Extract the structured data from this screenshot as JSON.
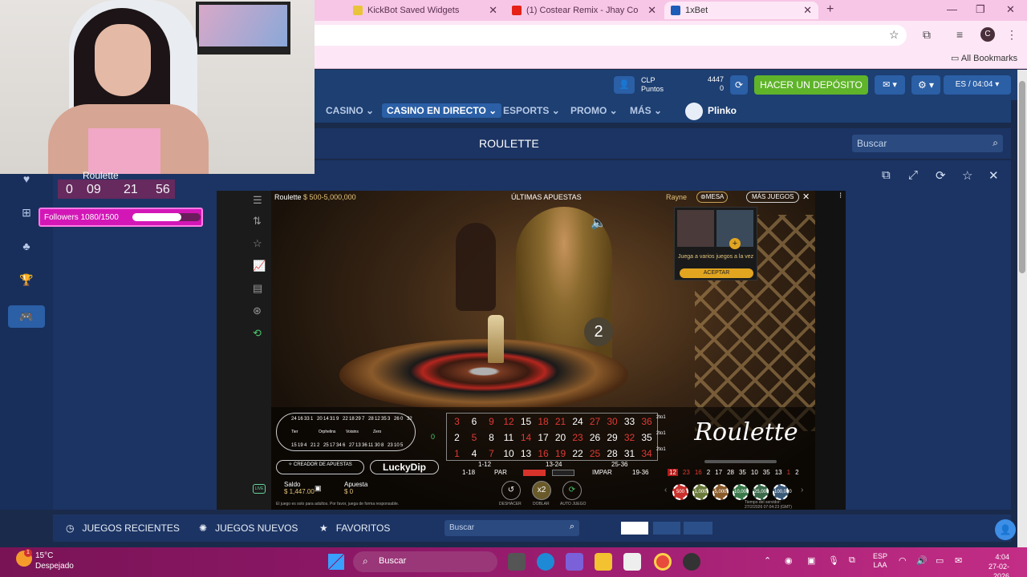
{
  "browser": {
    "tabs": [
      {
        "label": "KickBot Saved Widgets"
      },
      {
        "label": "(1) Costear Remix - Jhay Co"
      },
      {
        "label": "1xBet"
      }
    ],
    "all_bookmarks": "All Bookmarks",
    "profile_initial": "C"
  },
  "header": {
    "clp_label": "CLP",
    "points_label": "Puntos",
    "clp_value": "4447",
    "points_value": "0",
    "deposit_label": "HACER UN DEPÓSITO",
    "lang_time": "ES / 04:04"
  },
  "nav": {
    "items": [
      {
        "label": "CASINO"
      },
      {
        "label": "CASINO EN DIRECTO"
      },
      {
        "label": "ESPORTS"
      },
      {
        "label": "PROMO"
      },
      {
        "label": "MÁS"
      }
    ],
    "plinko": "Plinko"
  },
  "page": {
    "title": "ROULETTE",
    "search_placeholder": "Buscar"
  },
  "game": {
    "name": "Roulette",
    "range": "$ 500-5,000,000",
    "ultimas": "ÚLTIMAS APUESTAS",
    "dealer": "Rayne",
    "mesa": "MESA",
    "mas_juegos": "MÁS JUEGOS",
    "result": "2",
    "popup_text": "Juega a varios juegos a la vez",
    "popup_button": "ACEPTAR",
    "creador": "CREADOR DE APUESTAS",
    "lucky": "LuckyDip",
    "saldo_label": "Saldo",
    "saldo_value": "$ 1,447.00",
    "apuesta_label": "Apuesta",
    "apuesta_value": "$ 0",
    "disclaimer": "El juego es solo para adultos. Por favor, juega de forma responsable.",
    "live": "LIVE",
    "logo": "Roulette",
    "dozens": [
      "1-12",
      "13-24",
      "25-36"
    ],
    "outside": [
      "1-18",
      "PAR",
      "IMPAR",
      "19-36"
    ],
    "col_labels": [
      "2to1",
      "2to1",
      "2to1"
    ],
    "grid_rows": [
      [
        "3",
        "6",
        "9",
        "12",
        "15",
        "18",
        "21",
        "24",
        "27",
        "30",
        "33",
        "36"
      ],
      [
        "2",
        "5",
        "8",
        "11",
        "14",
        "17",
        "20",
        "23",
        "26",
        "29",
        "32",
        "35"
      ],
      [
        "1",
        "4",
        "7",
        "10",
        "13",
        "16",
        "19",
        "22",
        "25",
        "28",
        "31",
        "34"
      ]
    ],
    "red_numbers": [
      "3",
      "9",
      "12",
      "18",
      "21",
      "27",
      "30",
      "36",
      "5",
      "14",
      "23",
      "32",
      "1",
      "7",
      "16",
      "19",
      "25",
      "34"
    ],
    "zero": "0",
    "history": [
      "12",
      "23",
      "16",
      "2",
      "17",
      "28",
      "35",
      "10",
      "35",
      "13",
      "1",
      "2"
    ],
    "history_red": [
      "12",
      "23",
      "16",
      "1"
    ],
    "actions": [
      {
        "label": "DESHACER"
      },
      {
        "label": "DOBLAR"
      },
      {
        "label": "AUTO JUEGO"
      }
    ],
    "double_label": "x2",
    "chips": [
      "500",
      "1,000",
      "5,000",
      "10,000",
      "25,000",
      "100,000"
    ],
    "server_time_label": "Tiempo del servidor:",
    "server_time": "27/2/2026 07:04:23 (GMT)",
    "race_numbers": [
      "24",
      "16",
      "33",
      "1",
      "20",
      "14",
      "31",
      "9",
      "22",
      "18",
      "29",
      "7",
      "28",
      "12",
      "35",
      "3",
      "26",
      "0",
      "32",
      "15",
      "19",
      "4",
      "21",
      "2",
      "25",
      "17",
      "34",
      "6",
      "27",
      "13",
      "36",
      "11",
      "30",
      "8",
      "23",
      "10",
      "5"
    ],
    "race_labels": [
      "Tier",
      "Orphelins",
      "Voisins",
      "Zero"
    ]
  },
  "overlay": {
    "title": "Roulette",
    "timer": [
      "0",
      "09",
      "21",
      "56"
    ],
    "followers_label": "Followers 1080/1500",
    "followers_progress": 0.72
  },
  "bottom": {
    "recientes": "JUEGOS RECIENTES",
    "nuevos": "JUEGOS NUEVOS",
    "favoritos": "FAVORITOS",
    "search_placeholder": "Buscar"
  },
  "taskbar": {
    "temp": "15°C",
    "weather": "Despejado",
    "search_placeholder": "Buscar",
    "lang1": "ESP",
    "lang2": "LAA",
    "time": "4:04",
    "date": "27-02-2026",
    "badge": "1"
  }
}
